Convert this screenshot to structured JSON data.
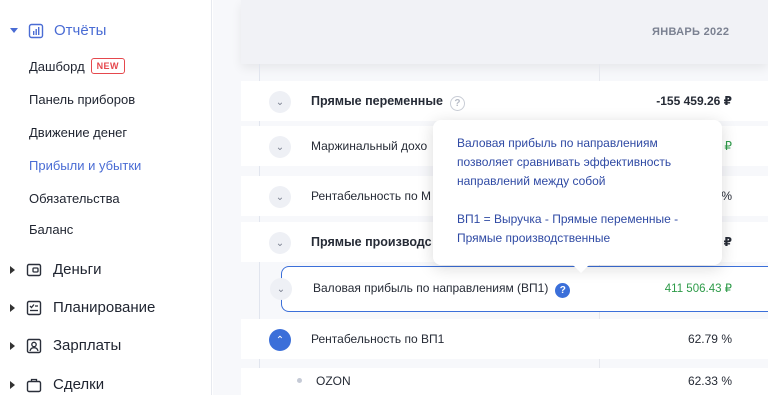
{
  "sidebar": {
    "section": {
      "label": "Отчёты"
    },
    "items": [
      {
        "label": "Дашборд",
        "badge": "NEW"
      },
      {
        "label": "Панель приборов"
      },
      {
        "label": "Движение денег"
      },
      {
        "label": "Прибыли и убытки"
      },
      {
        "label": "Обязательства"
      },
      {
        "label": "Баланс"
      }
    ],
    "groups": [
      {
        "label": "Деньги",
        "icon": "wallet-icon"
      },
      {
        "label": "Планирование",
        "icon": "planning-icon"
      },
      {
        "label": "Зарплаты",
        "icon": "person-icon"
      },
      {
        "label": "Сделки",
        "icon": "briefcase-icon"
      }
    ]
  },
  "header": {
    "month": "ЯНВАРЬ 2022"
  },
  "rows": [
    {
      "label": "Прямые переменные",
      "value": "-155 459.26 ₽"
    },
    {
      "label": "Маржинальный дохо",
      "value": "₽"
    },
    {
      "label": "Рентабельность по М",
      "value": "%"
    },
    {
      "label": "Прямые производс",
      "value": "₽"
    },
    {
      "label": "Валовая прибыль по направлениям (ВП1)",
      "value": "411 506.43 ₽"
    },
    {
      "label": "Рентабельность по ВП1",
      "value": "62.79 %"
    },
    {
      "label": "OZON",
      "value": "62.33 %"
    }
  ],
  "tooltip": {
    "line1": "Валовая прибыль по направлениям",
    "line2": "позволяет сравнивать эффективность",
    "line3": "направлений между собой",
    "line4": "ВП1 = Выручка - Прямые переменные -",
    "line5": "Прямые производственные"
  },
  "icons": {
    "help": "?"
  },
  "colors": {
    "accent": "#3b6fd9",
    "positive": "#2e9b49",
    "badge": "#e5484d"
  }
}
